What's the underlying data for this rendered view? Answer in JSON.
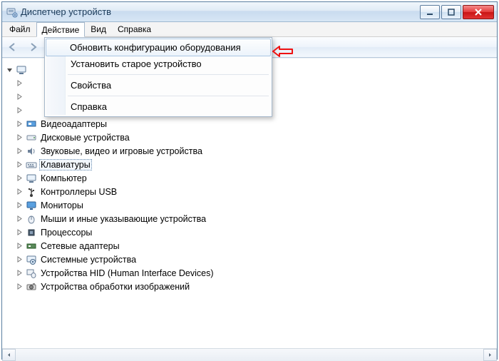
{
  "title": "Диспетчер устройств",
  "menubar": {
    "file": "Файл",
    "action": "Действие",
    "view": "Вид",
    "help": "Справка"
  },
  "dropdown": {
    "scan": "Обновить конфигурацию оборудования",
    "legacy": "Установить старое устройство",
    "properties": "Свойства",
    "help": "Справка"
  },
  "tree": {
    "root": "",
    "items": [
      "",
      "",
      "",
      "Видеоадаптеры",
      "Дисковые устройства",
      "Звуковые, видео и игровые устройства",
      "Клавиатуры",
      "Компьютер",
      "Контроллеры USB",
      "Мониторы",
      "Мыши и иные указывающие устройства",
      "Процессоры",
      "Сетевые адаптеры",
      "Системные устройства",
      "Устройства HID (Human Interface Devices)",
      "Устройства обработки изображений"
    ]
  }
}
